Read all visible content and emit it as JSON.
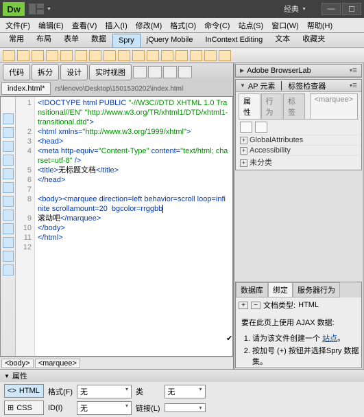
{
  "app": {
    "logo": "Dw",
    "mode": "经典"
  },
  "window_buttons": {
    "min": "—",
    "max": "☐",
    "close": "×"
  },
  "menu": [
    "文件(F)",
    "编辑(E)",
    "查看(V)",
    "插入(I)",
    "修改(M)",
    "格式(O)",
    "命令(C)",
    "站点(S)",
    "窗口(W)",
    "帮助(H)"
  ],
  "category_tabs": [
    "常用",
    "布局",
    "表单",
    "数据",
    "Spry",
    "jQuery Mobile",
    "InContext Editing",
    "文本",
    "收藏夹"
  ],
  "active_category": "Spry",
  "view_buttons": [
    "代码",
    "拆分",
    "设计",
    "实时视图"
  ],
  "file_tab": "index.html*",
  "file_path": "rs\\lenovo\\Desktop\\1501530202\\index.html",
  "code_lines": [
    {
      "n": "1",
      "parts": [
        {
          "t": "tag",
          "v": "<!DOCTYPE html PUBLIC "
        },
        {
          "t": "str",
          "v": "\"-//W3C//DTD XHTML 1.0 Transitional//EN\""
        },
        {
          "t": "tag",
          "v": " "
        },
        {
          "t": "str",
          "v": "\"http://www.w3.org/TR/xhtml1/DTD/xhtml1-transitional.dtd\""
        },
        {
          "t": "tag",
          "v": ">"
        }
      ]
    },
    {
      "n": "2",
      "parts": [
        {
          "t": "tag",
          "v": "<html xmlns="
        },
        {
          "t": "str",
          "v": "\"http://www.w3.org/1999/xhtml\""
        },
        {
          "t": "tag",
          "v": ">"
        }
      ]
    },
    {
      "n": "3",
      "parts": [
        {
          "t": "tag",
          "v": "<head>"
        }
      ]
    },
    {
      "n": "4",
      "parts": [
        {
          "t": "tag",
          "v": "<meta http-equiv="
        },
        {
          "t": "str",
          "v": "\"Content-Type\""
        },
        {
          "t": "tag",
          "v": " content="
        },
        {
          "t": "str",
          "v": "\"text/html; charset=utf-8\""
        },
        {
          "t": "tag",
          "v": " />"
        }
      ]
    },
    {
      "n": "5",
      "parts": [
        {
          "t": "tag",
          "v": "<title>"
        },
        {
          "t": "txt",
          "v": "无标题文档"
        },
        {
          "t": "tag",
          "v": "</title>"
        }
      ]
    },
    {
      "n": "6",
      "parts": [
        {
          "t": "tag",
          "v": "</head>"
        }
      ]
    },
    {
      "n": "7",
      "parts": []
    },
    {
      "n": "8",
      "parts": [
        {
          "t": "tag",
          "v": "<body><marquee direction=left behavior=scroll loop=infinite scrollamount=20  bgcolor=rrggbb"
        },
        {
          "t": "caret",
          "v": ""
        }
      ]
    },
    {
      "n": "9",
      "parts": [
        {
          "t": "txt",
          "v": "滚动吧"
        },
        {
          "t": "tag",
          "v": "</marquee>"
        }
      ]
    },
    {
      "n": "10",
      "parts": [
        {
          "t": "tag",
          "v": "</body>"
        }
      ]
    },
    {
      "n": "11",
      "parts": [
        {
          "t": "tag",
          "v": "</html>"
        }
      ]
    },
    {
      "n": "12",
      "parts": []
    }
  ],
  "breadcrumb": [
    "body",
    "marquee"
  ],
  "panels": {
    "browserlab": "Adobe BrowserLab",
    "ap_title": "AP 元素",
    "tag_inspector_title": "标签检查器",
    "tag_inspector": {
      "tabs": [
        "属性",
        "行为",
        "标签"
      ],
      "tag": "<marquee>",
      "groups": [
        "GlobalAttributes",
        "Accessibility",
        "未分类"
      ]
    },
    "bind": {
      "tabs": [
        "数据库",
        "绑定",
        "服务器行为"
      ],
      "active_tab": "绑定",
      "doctype_label": "文档类型:",
      "doctype_value": "HTML",
      "msg": "要在此页上使用 AJAX 数据:",
      "steps": [
        "请为该文件创建一个",
        "站点",
        "。",
        "按加号 (+) 按钮并选择Spry 数据集。"
      ]
    }
  },
  "props": {
    "title": "属性",
    "left_tabs": [
      "HTML",
      "CSS"
    ],
    "labels": {
      "format": "格式(F)",
      "id": "ID(I)",
      "class": "类",
      "link": "链接(L)"
    },
    "values": {
      "format": "无",
      "id": "无",
      "class": "无"
    }
  }
}
